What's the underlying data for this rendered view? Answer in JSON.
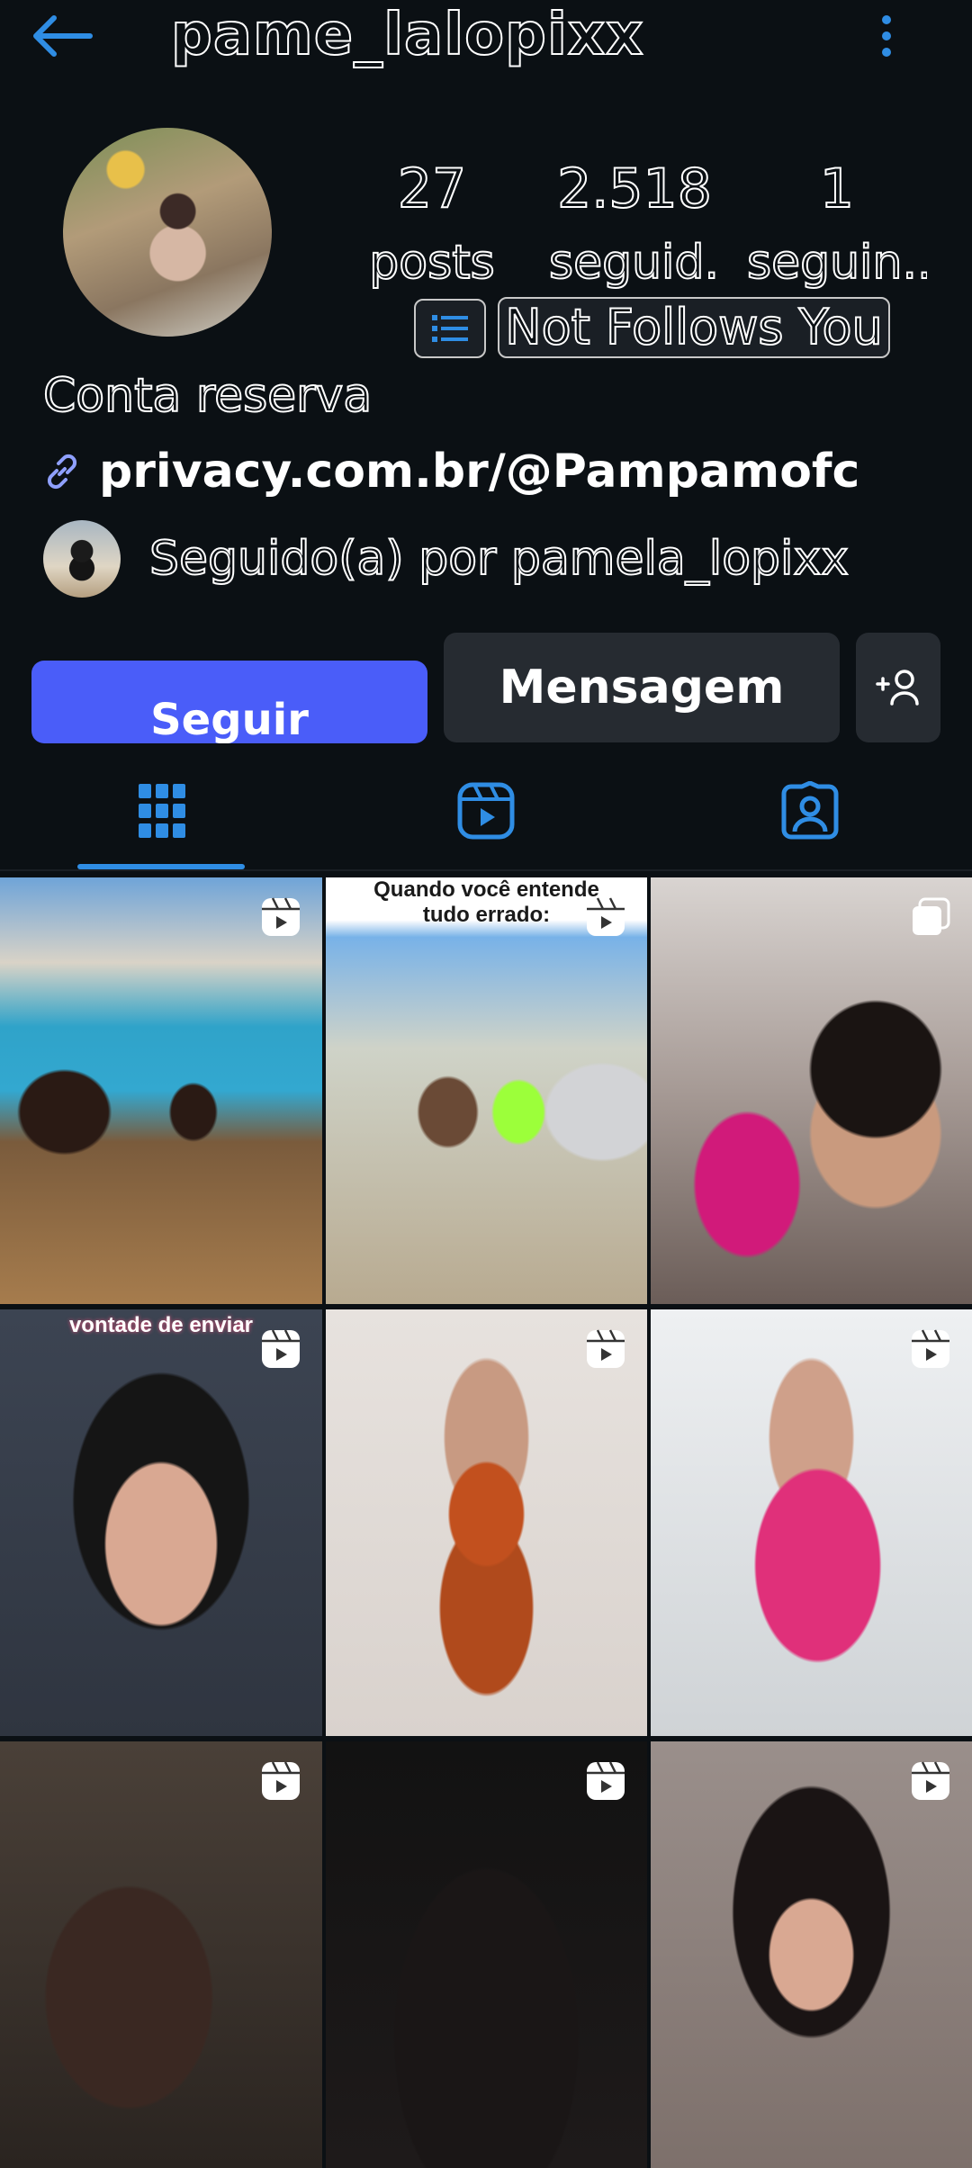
{
  "header": {
    "username": "pame_lalopixx",
    "back_icon": "arrow-left-icon",
    "menu_icon": "more-vertical-icon",
    "accent_color": "#2f8de4"
  },
  "profile": {
    "stats": [
      {
        "value": "27",
        "label": "posts"
      },
      {
        "value": "2.518",
        "label": "seguid..."
      },
      {
        "value": "1",
        "label": "seguin..."
      }
    ],
    "relationship_badge": "Not Follows You",
    "bio_name": "Conta reserva",
    "link": "privacy.com.br/@Pampamofc",
    "followed_by": "Seguido(a) por pamela_lopixx"
  },
  "actions": {
    "follow_label": "Seguir",
    "message_label": "Mensagem",
    "follow_color": "#4a5df9"
  },
  "tabs": [
    {
      "icon": "grid-icon",
      "active": true
    },
    {
      "icon": "reels-icon",
      "active": false
    },
    {
      "icon": "tagged-icon",
      "active": false
    }
  ],
  "posts": [
    {
      "type": "reel",
      "caption": ""
    },
    {
      "type": "reel",
      "caption": "Quando você entende tudo errado:"
    },
    {
      "type": "carousel",
      "caption": ""
    },
    {
      "type": "reel",
      "caption": "vontade de enviar"
    },
    {
      "type": "reel",
      "caption": ""
    },
    {
      "type": "reel",
      "caption": ""
    },
    {
      "type": "reel",
      "caption": ""
    },
    {
      "type": "reel",
      "caption": ""
    },
    {
      "type": "reel",
      "caption": ""
    }
  ]
}
